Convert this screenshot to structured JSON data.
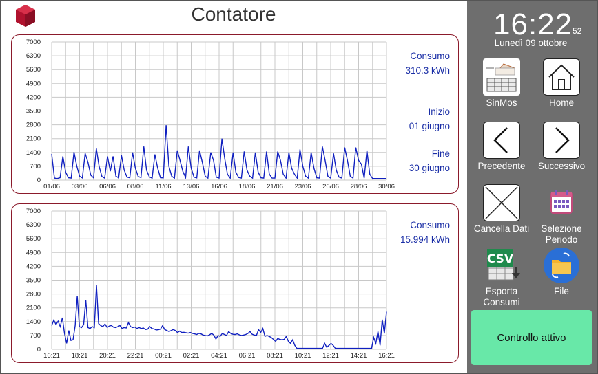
{
  "header": {
    "title": "Contatore"
  },
  "chart_data": [
    {
      "type": "line",
      "ylim": [
        0,
        7000
      ],
      "yticks": [
        0,
        700,
        1400,
        2100,
        2800,
        3500,
        4200,
        4900,
        5600,
        6300,
        7000
      ],
      "xtick_labels": [
        "01/06",
        "03/06",
        "06/06",
        "08/06",
        "11/06",
        "13/06",
        "16/06",
        "18/06",
        "21/06",
        "23/06",
        "26/06",
        "28/06",
        "30/06"
      ],
      "line_color": "#1020c0",
      "grid": true,
      "series": [
        {
          "values": [
            1320,
            100,
            80,
            120,
            1200,
            400,
            120,
            100,
            1420,
            700,
            200,
            110,
            1350,
            900,
            250,
            120,
            1600,
            700,
            180,
            100,
            1200,
            450,
            1200,
            200,
            120,
            1250,
            500,
            150,
            120,
            1400,
            600,
            180,
            130,
            1700,
            500,
            160,
            100,
            1300,
            600,
            120,
            110,
            2780,
            700,
            200,
            100,
            1500,
            1000,
            450,
            130,
            1700,
            600,
            150,
            110,
            1500,
            900,
            200,
            100,
            1400,
            1000,
            150,
            100,
            2100,
            1100,
            300,
            100,
            1400,
            400,
            130,
            100,
            1450,
            500,
            200,
            100,
            1400,
            400,
            120,
            100,
            1450,
            300,
            100,
            100,
            1450,
            1000,
            300,
            100,
            1400,
            600,
            300,
            100,
            1550,
            700,
            200,
            100,
            1400,
            600,
            120,
            100,
            1700,
            1000,
            200,
            100,
            1350,
            500,
            150,
            100,
            1650,
            1000,
            200,
            100,
            1650,
            1000,
            800,
            100,
            1500,
            300,
            80,
            80,
            80,
            80,
            80,
            80
          ]
        }
      ]
    },
    {
      "type": "line",
      "ylim": [
        0,
        7000
      ],
      "yticks": [
        0,
        700,
        1400,
        2100,
        2800,
        3500,
        4200,
        4900,
        5600,
        6300,
        7000
      ],
      "xtick_labels": [
        "16:21",
        "18:21",
        "20:21",
        "22:21",
        "00:21",
        "02:21",
        "04:21",
        "06:21",
        "08:21",
        "10:21",
        "12:21",
        "14:21",
        "16:21"
      ],
      "line_color": "#1020c0",
      "grid": true,
      "series": [
        {
          "values": [
            1200,
            1480,
            1250,
            1420,
            1150,
            1600,
            800,
            300,
            950,
            450,
            480,
            1200,
            2700,
            1150,
            1100,
            1250,
            2500,
            1100,
            1050,
            1150,
            1100,
            3250,
            1300,
            1200,
            1150,
            1280,
            1100,
            1180,
            1200,
            1120,
            1100,
            1150,
            1200,
            1050,
            1100,
            1080,
            1350,
            1150,
            1100,
            1130,
            1050,
            1100,
            1050,
            1080,
            1000,
            1020,
            1150,
            1050,
            1030,
            980,
            990,
            1020,
            1200,
            1000,
            950,
            900,
            950,
            1000,
            950,
            850,
            920,
            850,
            860,
            840,
            820,
            850,
            800,
            780,
            750,
            800,
            780,
            720,
            700,
            680,
            730,
            800,
            720,
            520,
            700,
            650,
            800,
            750,
            700,
            900,
            800,
            760,
            750,
            780,
            730,
            700,
            720,
            750,
            800,
            900,
            760,
            720,
            700,
            1000,
            850,
            1050,
            650,
            700,
            650,
            600,
            500,
            400,
            550,
            500,
            480,
            500,
            650,
            400,
            300,
            480,
            200,
            50,
            50,
            50,
            50,
            50,
            50,
            50,
            50,
            50,
            50,
            50,
            50,
            50,
            300,
            100,
            200,
            300,
            200,
            50,
            50,
            50,
            50,
            50,
            50,
            50,
            50,
            50,
            50,
            50,
            50,
            50,
            50,
            50,
            50,
            50,
            50,
            600,
            300,
            900,
            200,
            1500,
            800,
            1900
          ]
        }
      ]
    }
  ],
  "top_panel": {
    "consumo_label": "Consumo",
    "consumo_value": "310.3 kWh",
    "inizio_label": "Inizio",
    "inizio_value": "01 giugno",
    "fine_label": "Fine",
    "fine_value": "30 giugno"
  },
  "bottom_panel": {
    "consumo_label": "Consumo",
    "consumo_value": "15.994 kWh"
  },
  "sidebar": {
    "time": "16:22",
    "seconds": "52",
    "date": "Lunedì 09 ottobre",
    "buttons": {
      "sinmos": "SinMos",
      "home": "Home",
      "precedente": "Precedente",
      "successivo": "Successivo",
      "cancella": "Cancella Dati",
      "selezione": "Selezione Periodo",
      "esporta": "Esporta Consumi",
      "csv_text": "CSV",
      "file": "File"
    },
    "controllo": "Controllo attivo"
  },
  "colors": {
    "accent_border": "#8b1a2b",
    "sidebar_bg": "#6e6e6e",
    "controllo_bg": "#68e8a8",
    "info_text": "#1a2ea6",
    "line": "#1020c0"
  }
}
